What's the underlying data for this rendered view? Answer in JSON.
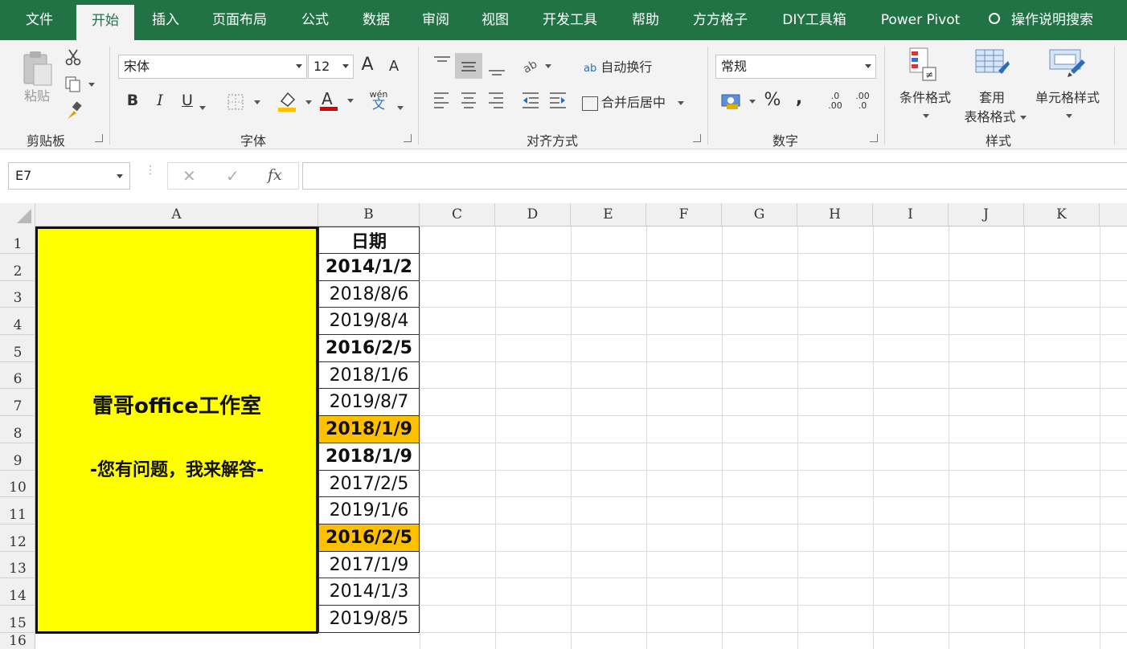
{
  "menu": {
    "tabs": [
      {
        "label": "文件"
      },
      {
        "label": "开始"
      },
      {
        "label": "插入"
      },
      {
        "label": "页面布局"
      },
      {
        "label": "公式"
      },
      {
        "label": "数据"
      },
      {
        "label": "审阅"
      },
      {
        "label": "视图"
      },
      {
        "label": "开发工具"
      },
      {
        "label": "帮助"
      },
      {
        "label": "方方格子"
      },
      {
        "label": "DIY工具箱"
      },
      {
        "label": "Power Pivot"
      }
    ],
    "active_tab": "开始",
    "tell_me": "操作说明搜索"
  },
  "ribbon": {
    "clipboard": {
      "paste": "粘贴",
      "label": "剪贴板"
    },
    "font": {
      "name": "宋体",
      "size": "12",
      "label": "字体",
      "bold": "B",
      "italic": "I",
      "underline": "U",
      "grow": "A",
      "shrink": "A",
      "phonetic_top": "wén",
      "phonetic_bottom": "文"
    },
    "alignment": {
      "wrap": "自动换行",
      "merge": "合并后居中",
      "label": "对齐方式",
      "wrap_icon": "ab"
    },
    "number": {
      "format": "常规",
      "percent": "%",
      "comma": ",",
      "inc_decimal": ".00",
      "dec_decimal": ".0",
      "label": "数字"
    },
    "styles": {
      "conditional": "条件格式",
      "table_top": "套用",
      "table_bottom": "表格格式",
      "cell_styles": "单元格样式",
      "label": "样式"
    }
  },
  "formula_bar": {
    "name_box": "E7",
    "cancel": "✕",
    "enter": "✓",
    "fx": "fx",
    "formula": ""
  },
  "sheet": {
    "columns": [
      "A",
      "B",
      "C",
      "D",
      "E",
      "F",
      "G",
      "H",
      "I",
      "J",
      "K"
    ],
    "rows": [
      "1",
      "2",
      "3",
      "4",
      "5",
      "6",
      "7",
      "8",
      "9",
      "10",
      "11",
      "12",
      "13",
      "14",
      "15",
      "16"
    ],
    "merged_a": {
      "line1": "雷哥office工作室",
      "line2": "-您有问题，我来解答-"
    },
    "colors": {
      "merged_fill": "#ffff00",
      "highlight_fill": "#ffc000",
      "header_bar": "#217346"
    },
    "b_cells": [
      {
        "value": "日期",
        "bold": true,
        "highlight": false
      },
      {
        "value": "2014/1/2",
        "bold": true,
        "highlight": false
      },
      {
        "value": "2018/8/6",
        "bold": false,
        "highlight": false
      },
      {
        "value": "2019/8/4",
        "bold": false,
        "highlight": false
      },
      {
        "value": "2016/2/5",
        "bold": true,
        "highlight": false
      },
      {
        "value": "2018/1/6",
        "bold": false,
        "highlight": false
      },
      {
        "value": "2019/8/7",
        "bold": false,
        "highlight": false
      },
      {
        "value": "2018/1/9",
        "bold": true,
        "highlight": true
      },
      {
        "value": "2018/1/9",
        "bold": true,
        "highlight": false
      },
      {
        "value": "2017/2/5",
        "bold": false,
        "highlight": false
      },
      {
        "value": "2019/1/6",
        "bold": false,
        "highlight": false
      },
      {
        "value": "2016/2/5",
        "bold": true,
        "highlight": true
      },
      {
        "value": "2017/1/9",
        "bold": false,
        "highlight": false
      },
      {
        "value": "2014/1/3",
        "bold": false,
        "highlight": false
      },
      {
        "value": "2019/8/5",
        "bold": false,
        "highlight": false
      }
    ]
  }
}
